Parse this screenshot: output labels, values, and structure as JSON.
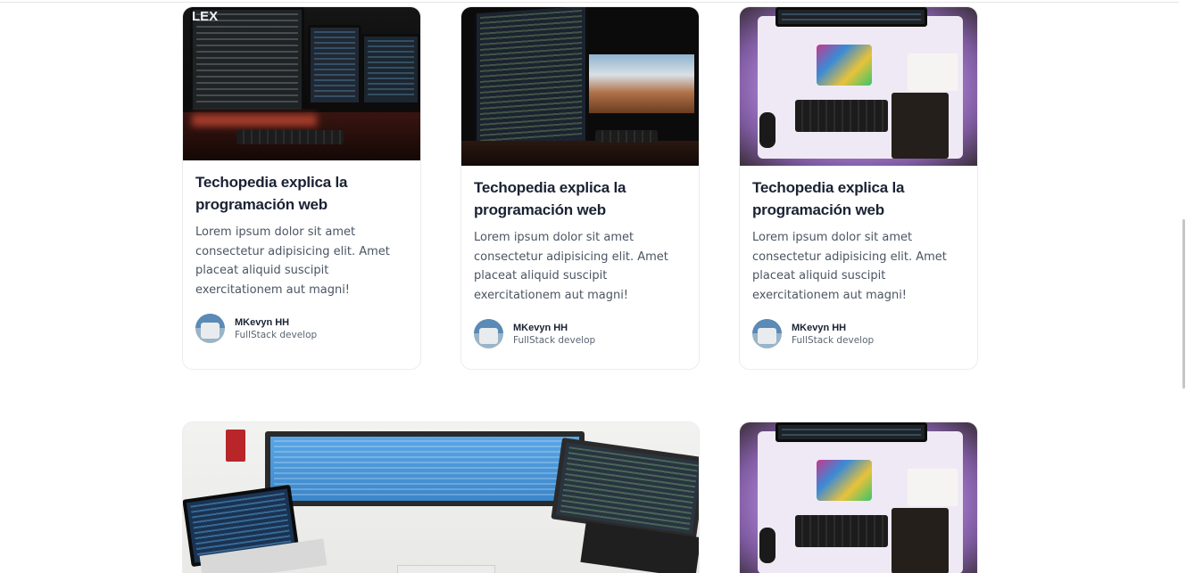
{
  "cards": [
    {
      "title": "Techopedia explica la programación web",
      "text": "Lorem ipsum dolor sit amet consectetur adipisicing elit. Amet placeat aliquid suscipit exercitationem aut magni!",
      "author_name": "MKevyn HH",
      "author_role": "FullStack develop",
      "image": "dual-monitor-red-glow-photo"
    },
    {
      "title": "Techopedia explica la programación web",
      "text": "Lorem ipsum dolor sit amet consectetur adipisicing elit. Amet placeat aliquid suscipit exercitationem aut magni!",
      "author_name": "MKevyn HH",
      "author_role": "FullStack develop",
      "image": "code-monitor-and-landscape-photo"
    },
    {
      "title": "Techopedia explica la programación web",
      "text": "Lorem ipsum dolor sit amet consectetur adipisicing elit. Amet placeat aliquid suscipit exercitationem aut magni!",
      "author_name": "MKevyn HH",
      "author_role": "FullStack develop",
      "image": "purple-desk-top-view-photo"
    }
  ],
  "wide_card": {
    "image": "office-desk-monitors-photo"
  },
  "bottom_right_card": {
    "image": "purple-desk-top-view-photo"
  },
  "colors": {
    "title": "#1a2233",
    "text": "#4b5563",
    "border": "#ececec"
  }
}
